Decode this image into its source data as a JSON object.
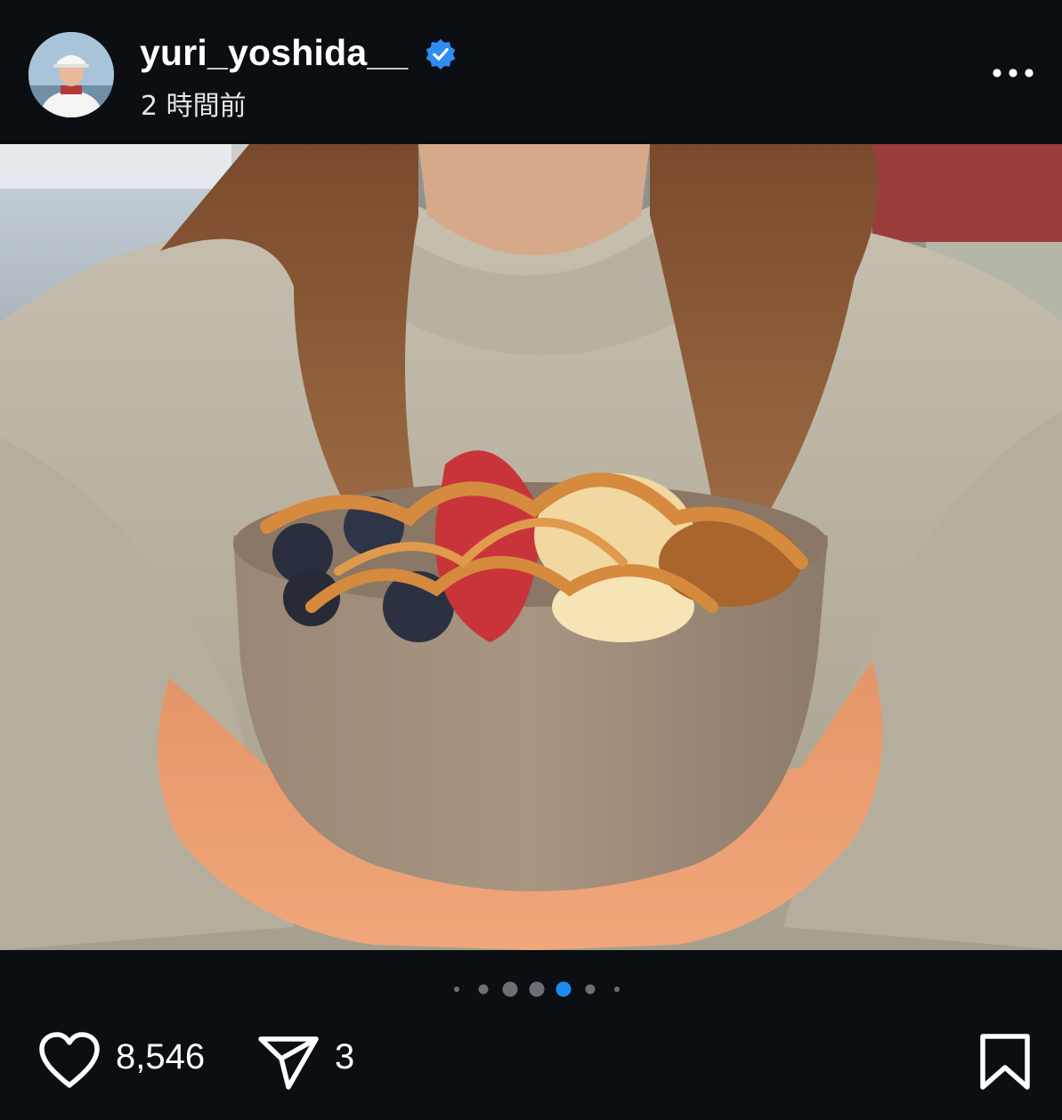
{
  "post": {
    "username": "yuri_yoshida__",
    "verified": true,
    "time_ago": "2 時間前",
    "more_icon": "more-horizontal-icon"
  },
  "media": {
    "slide_count": 7,
    "active_slide": 5
  },
  "actions": {
    "like_icon": "heart-icon",
    "like_count": "8,546",
    "share_icon": "paper-plane-icon",
    "share_count": "3",
    "save_icon": "bookmark-icon"
  },
  "colors": {
    "background": "#0b0e13",
    "verified_badge": "#2f8cf1",
    "active_dot": "#1d8cf1",
    "inactive_dot": "#6b6f76"
  }
}
